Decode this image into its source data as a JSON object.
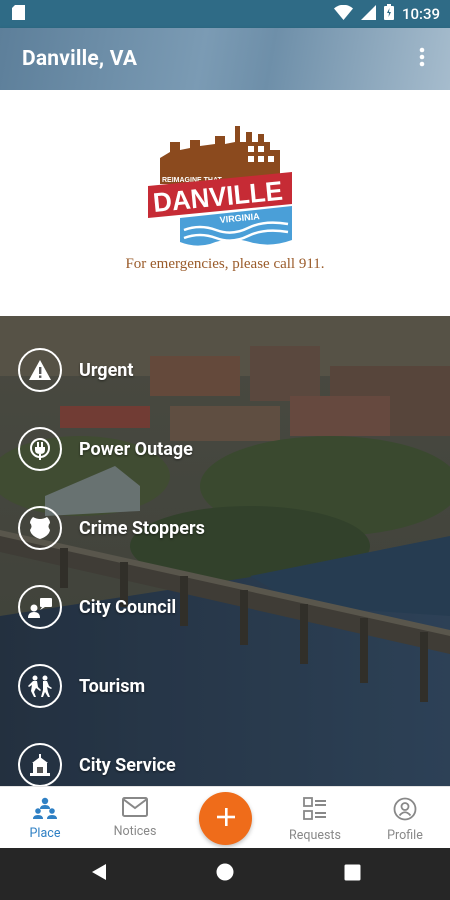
{
  "status_bar": {
    "time": "10:39",
    "left_icons": [
      "sd-card-icon"
    ],
    "right_icons": [
      "wifi-icon",
      "cell-signal-icon",
      "battery-icon"
    ]
  },
  "app_bar": {
    "title": "Danville, VA",
    "menu_icon": "more-vert-icon"
  },
  "logo": {
    "tagline": "REIMAGINE THAT",
    "name": "DANVILLE",
    "state": "VIRGINIA"
  },
  "emergency_text": "For emergencies, please call 911.",
  "menu": [
    {
      "label": "Urgent",
      "icon": "warning-icon"
    },
    {
      "label": "Power Outage",
      "icon": "power-plug-icon"
    },
    {
      "label": "Crime Stoppers",
      "icon": "police-badge-icon"
    },
    {
      "label": "City Council",
      "icon": "council-speaker-icon"
    },
    {
      "label": "Tourism",
      "icon": "tourism-people-icon"
    },
    {
      "label": "City Service",
      "icon": "city-building-icon"
    }
  ],
  "bottom_nav": {
    "place": {
      "label": "Place",
      "icon": "place-icon",
      "active": true
    },
    "notices": {
      "label": "Notices",
      "icon": "envelope-icon"
    },
    "add": {
      "icon": "plus-icon"
    },
    "requests": {
      "label": "Requests",
      "icon": "checklist-icon"
    },
    "profile": {
      "label": "Profile",
      "icon": "profile-icon"
    }
  },
  "colors": {
    "status_bar": "#2f6b86",
    "accent_active": "#2f80c4",
    "fab": "#ef6c1a",
    "logo_brown": "#8b4a1e",
    "logo_red": "#c62b35",
    "logo_blue": "#4a9fd8",
    "emergency_text": "#9a5b2a"
  }
}
